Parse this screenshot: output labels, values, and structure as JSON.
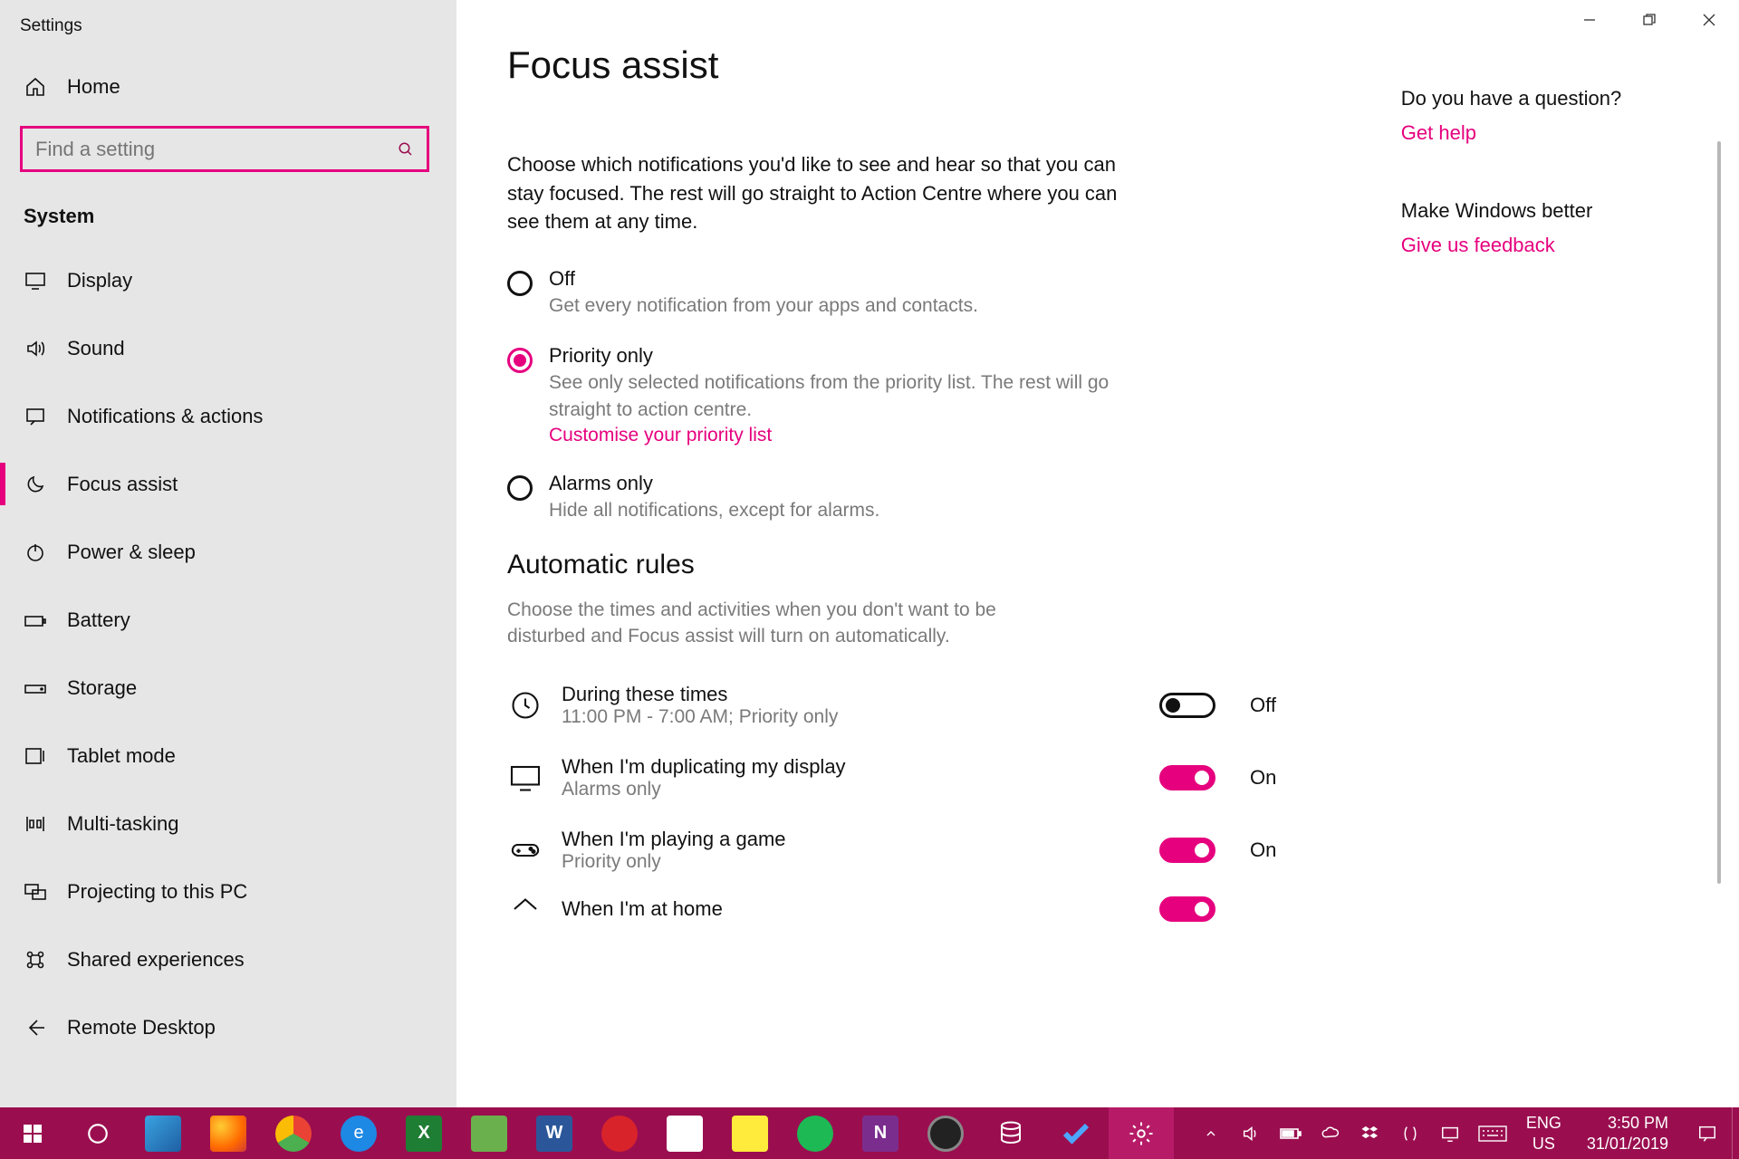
{
  "app_title": "Settings",
  "search_placeholder": "Find a setting",
  "home_label": "Home",
  "category_header": "System",
  "sidebar_items": [
    {
      "label": "Display"
    },
    {
      "label": "Sound"
    },
    {
      "label": "Notifications & actions"
    },
    {
      "label": "Focus assist"
    },
    {
      "label": "Power & sleep"
    },
    {
      "label": "Battery"
    },
    {
      "label": "Storage"
    },
    {
      "label": "Tablet mode"
    },
    {
      "label": "Multi-tasking"
    },
    {
      "label": "Projecting to this PC"
    },
    {
      "label": "Shared experiences"
    },
    {
      "label": "Remote Desktop"
    }
  ],
  "page_title": "Focus assist",
  "intro_desc": "Choose which notifications you'd like to see and hear so that you can stay focused. The rest will go straight to Action Centre where you can see them at any time.",
  "radios": [
    {
      "label": "Off",
      "sub": "Get every notification from your apps and contacts."
    },
    {
      "label": "Priority only",
      "sub": "See only selected notifications from the priority list. The rest will go straight to action centre.",
      "link": "Customise your priority list"
    },
    {
      "label": "Alarms only",
      "sub": "Hide all notifications, except for alarms."
    }
  ],
  "section2_title": "Automatic rules",
  "section2_desc": "Choose the times and activities when you don't want to be disturbed and Focus assist will turn on automatically.",
  "rules": [
    {
      "title": "During these times",
      "sub": "11:00 PM - 7:00 AM; Priority only",
      "state": "Off"
    },
    {
      "title": "When I'm duplicating my display",
      "sub": "Alarms only",
      "state": "On"
    },
    {
      "title": "When I'm playing a game",
      "sub": "Priority only",
      "state": "On"
    },
    {
      "title": "When I'm at home",
      "sub": "",
      "state": ""
    }
  ],
  "aside": {
    "q": "Do you have a question?",
    "help": "Get help",
    "better": "Make Windows better",
    "feedback": "Give us feedback"
  },
  "clock": {
    "time": "3:50 PM",
    "date": "31/01/2019",
    "lang1": "ENG",
    "lang2": "US"
  }
}
